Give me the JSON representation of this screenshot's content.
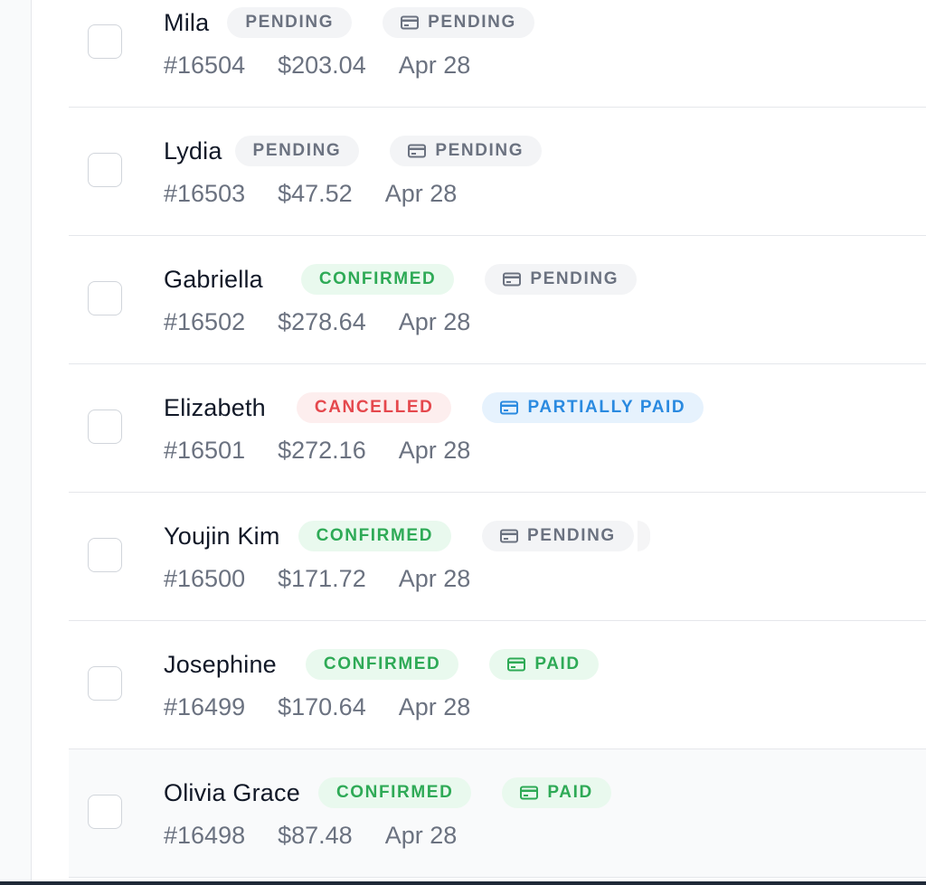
{
  "orders": [
    {
      "name": "Mila",
      "status": "PENDING",
      "status_color": "gray",
      "payment": "PENDING",
      "payment_color": "gray",
      "number": "#16504",
      "total": "$203.04",
      "date": "Apr 28"
    },
    {
      "name": "Lydia",
      "status": "PENDING",
      "status_color": "gray",
      "payment": "PENDING",
      "payment_color": "gray",
      "number": "#16503",
      "total": "$47.52",
      "date": "Apr 28"
    },
    {
      "name": "Gabriella",
      "status": "CONFIRMED",
      "status_color": "green",
      "payment": "PENDING",
      "payment_color": "gray",
      "number": "#16502",
      "total": "$278.64",
      "date": "Apr 28"
    },
    {
      "name": "Elizabeth",
      "status": "CANCELLED",
      "status_color": "red",
      "payment": "PARTIALLY PAID",
      "payment_color": "blue",
      "number": "#16501",
      "total": "$272.16",
      "date": "Apr 28"
    },
    {
      "name": "Youjin Kim",
      "status": "CONFIRMED",
      "status_color": "green",
      "payment": "PENDING",
      "payment_color": "gray",
      "number": "#16500",
      "total": "$171.72",
      "date": "Apr 28"
    },
    {
      "name": "Josephine",
      "status": "CONFIRMED",
      "status_color": "green",
      "payment": "PAID",
      "payment_color": "green",
      "number": "#16499",
      "total": "$170.64",
      "date": "Apr 28"
    },
    {
      "name": "Olivia Grace",
      "status": "CONFIRMED",
      "status_color": "green",
      "payment": "PAID",
      "payment_color": "green",
      "number": "#16498",
      "total": "$87.48",
      "date": "Apr 28"
    }
  ],
  "colors": {
    "gray_text": "#6b7280",
    "green_text": "#2eaa56",
    "red_text": "#e5484d",
    "blue_text": "#2a8ae0",
    "divider": "#e5e7eb"
  },
  "icons": {
    "payment": "credit-card-icon"
  }
}
